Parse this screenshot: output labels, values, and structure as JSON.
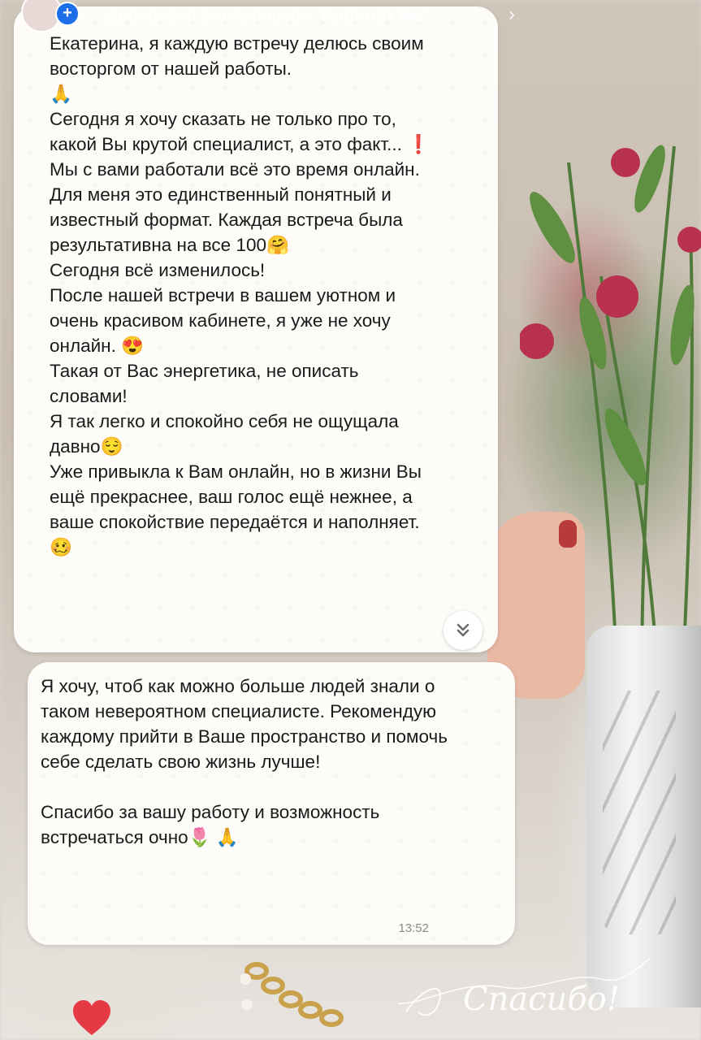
{
  "story": {
    "highlight_prefix": "Добавлено в актуальное \"",
    "highlight_name": "Кабинет 🛏",
    "highlight_suffix": "\"",
    "chevron": "›"
  },
  "messages": [
    {
      "text": "Екатерина, я каждую встречу делюсь своим восторгом от нашей работы.\n🙏\nСегодня я хочу сказать не только про то, какой Вы крутой специалист, а это факт... ❗\nМы с вами работали всё это время онлайн. Для меня это единственный понятный и известный формат. Каждая встреча была результативна на все 100🤗\nСегодня всё изменилось!\nПосле нашей встречи в вашем уютном и очень красивом кабинете, я уже не хочу онлайн. 😍\nТакая от Вас энергетика, не описать словами!\nЯ так легко и спокойно себя не ощущала давно😌\nУже привыкла к Вам онлайн, но в жизни Вы ещё прекраснее, ваш голос ещё нежнее, а ваше спокойствие передаётся и наполняет.🥴"
    },
    {
      "text": "Я хочу, чтоб как можно больше людей знали о таком невероятном специалисте. Рекомендую каждому прийти в Ваше пространство и помочь себе сделать свою жизнь лучше!\n\nСпасибо за вашу работу и возможность встречаться очно🌷 🙏",
      "time": "13:52"
    }
  ],
  "scroll_down_icon": "double-chevron-down-icon",
  "sticker_text": "Спасибо!",
  "colors": {
    "bubble": "#fefcf8",
    "heart": "#e63946",
    "plus_badge": "#1c6fe8"
  }
}
